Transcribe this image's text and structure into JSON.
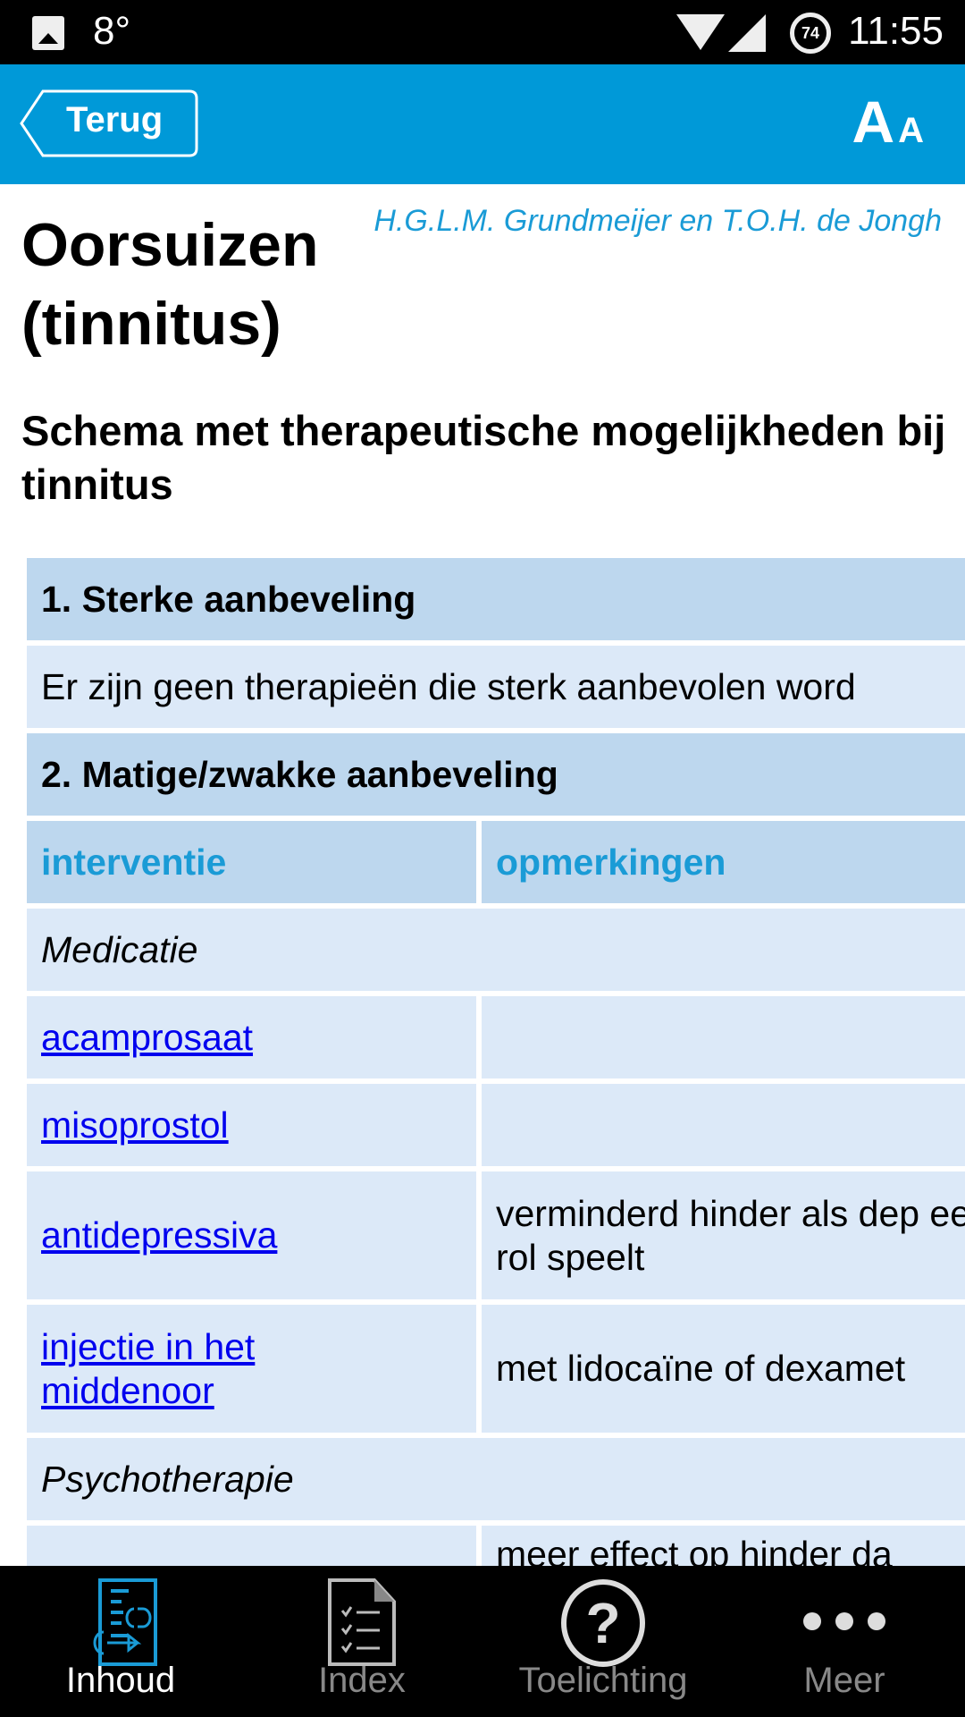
{
  "status_bar": {
    "temperature": "8°",
    "battery_level": "74",
    "time": "11:55"
  },
  "header": {
    "back_label": "Terug",
    "font_size_label_big": "A",
    "font_size_label_small": "A",
    "accent": "#0099d8"
  },
  "article": {
    "title": "Oorsuizen (tinnitus)",
    "authors": "H.G.L.M. Grundmeijer en T.O.H. de Jongh",
    "subtitle": "Schema met therapeutische mogelijkheden bij tinnitus"
  },
  "table": {
    "section1": "1. Sterke aanbeveling",
    "section1_text": "Er zijn geen therapieën die sterk aanbevolen word",
    "section2": "2. Matige/zwakke aanbeveling",
    "columns": [
      "interventie",
      "opmerkingen"
    ],
    "category1": "Medicatie",
    "rows": [
      {
        "interventie": "acamprosaat",
        "opmerkingen": ""
      },
      {
        "interventie": "misoprostol",
        "opmerkingen": ""
      },
      {
        "interventie": "antidepressiva",
        "opmerkingen": "verminderd hinder als dep een rol speelt"
      },
      {
        "interventie": "injectie in het middenoor",
        "opmerkingen": "met lidocaïne of dexamet"
      }
    ],
    "category2": "Psychotherapie",
    "partial_row_text": "meer effect op hinder da"
  },
  "bottom_nav": {
    "items": [
      {
        "label": "Inhoud",
        "icon": "contents-icon",
        "active": true
      },
      {
        "label": "Index",
        "icon": "index-document-icon",
        "active": false
      },
      {
        "label": "Toelichting",
        "icon": "help-icon",
        "active": false
      },
      {
        "label": "Meer",
        "icon": "more-icon",
        "active": false
      }
    ]
  }
}
